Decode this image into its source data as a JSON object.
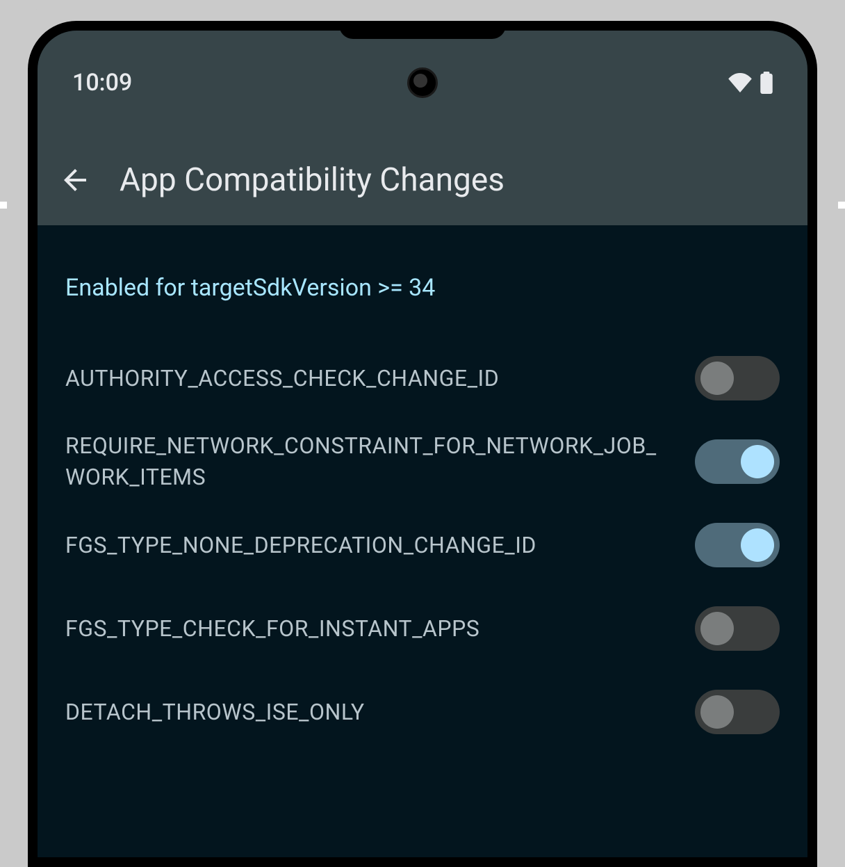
{
  "status": {
    "time": "10:09"
  },
  "appbar": {
    "title": "App Compatibility Changes"
  },
  "section": {
    "header": "Enabled for targetSdkVersion >= 34"
  },
  "toggles": [
    {
      "label": "AUTHORITY_ACCESS_CHECK_CHANGE_ID",
      "on": false
    },
    {
      "label": "REQUIRE_NETWORK_CONSTRAINT_FOR_NETWORK_JOB_WORK_ITEMS",
      "on": true
    },
    {
      "label": "FGS_TYPE_NONE_DEPRECATION_CHANGE_ID",
      "on": true
    },
    {
      "label": "FGS_TYPE_CHECK_FOR_INSTANT_APPS",
      "on": false
    },
    {
      "label": "DETACH_THROWS_ISE_ONLY",
      "on": false
    }
  ]
}
